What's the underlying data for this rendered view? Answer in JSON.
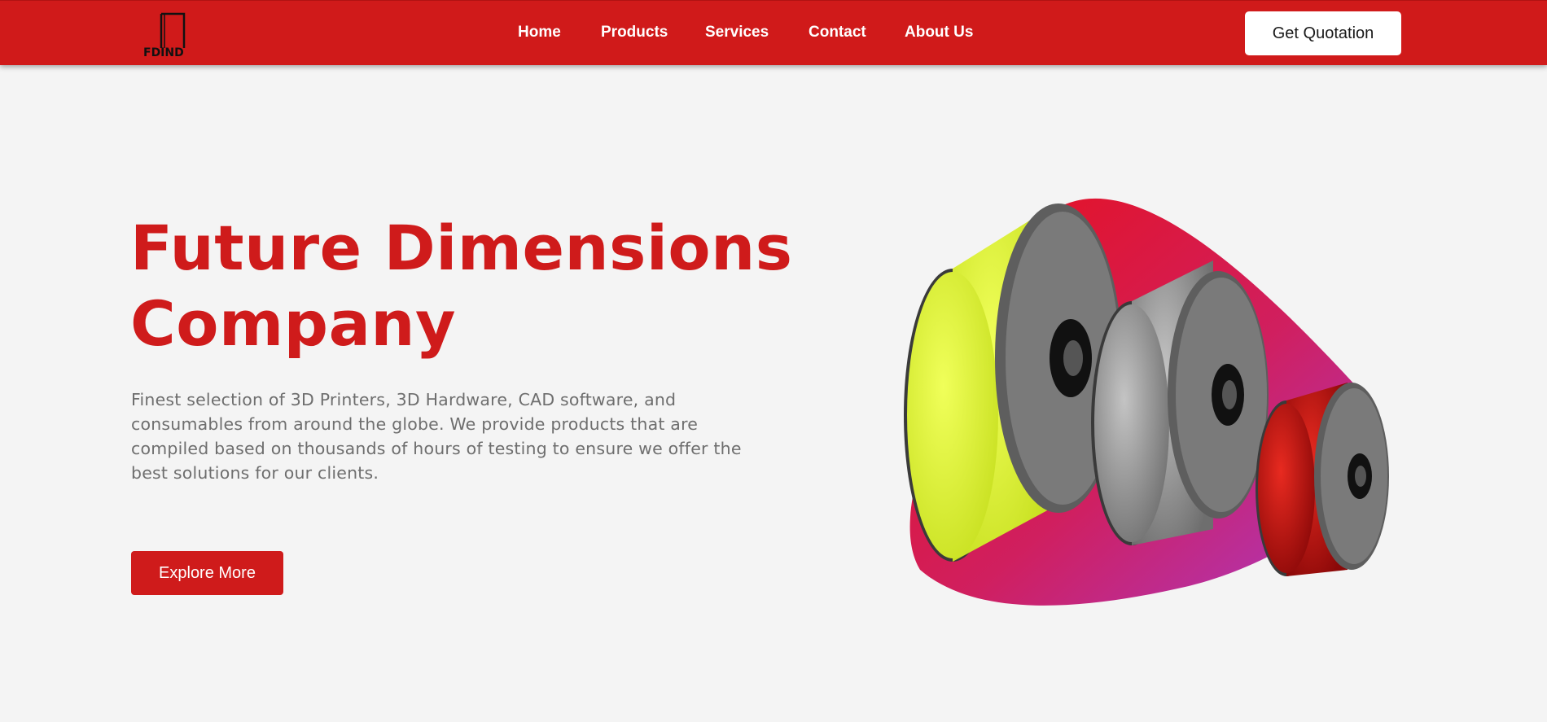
{
  "nav": {
    "logo_text": "FDIND",
    "links": [
      {
        "label": "Home"
      },
      {
        "label": "Products"
      },
      {
        "label": "Services"
      },
      {
        "label": "Contact"
      },
      {
        "label": "About Us"
      }
    ],
    "cta_label": "Get Quotation"
  },
  "hero": {
    "title_line1": "Future Dimensions",
    "title_line2": "Company",
    "description": "Finest selection of 3D Printers, 3D Hardware, CAD software, and consumables from around the globe. We provide products that are compiled based on thousands of hours of testing to ensure we offer the best solutions for our clients.",
    "button_label": "Explore More",
    "image_icon": "filament-spools-illustration"
  },
  "colors": {
    "brand_red": "#d01a1a",
    "background": "#f4f4f4",
    "blob_gradient_start": "#e8101a",
    "blob_gradient_end": "#a83ac8",
    "spool_yellow": "#e8ff3a",
    "spool_silver": "#9a9a9a",
    "spool_red": "#c81010"
  }
}
